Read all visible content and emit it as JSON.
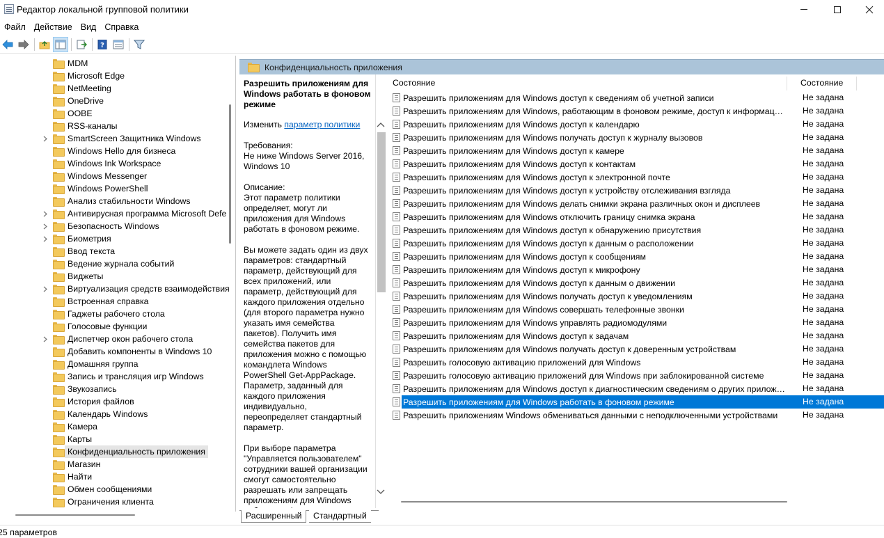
{
  "window": {
    "title": "Редактор локальной групповой политики"
  },
  "menu": [
    "Файл",
    "Действие",
    "Вид",
    "Справка"
  ],
  "toolbar": {
    "icons": [
      "back-arrow-icon",
      "forward-arrow-icon",
      "up-folder-icon",
      "show-hide-tree-icon",
      "export-list-icon",
      "help-icon",
      "properties-icon",
      "filter-icon"
    ]
  },
  "tree": {
    "items": [
      {
        "label": "MDM",
        "expandable": false
      },
      {
        "label": "Microsoft Edge",
        "expandable": false
      },
      {
        "label": "NetMeeting",
        "expandable": false
      },
      {
        "label": "OneDrive",
        "expandable": false
      },
      {
        "label": "OOBE",
        "expandable": false
      },
      {
        "label": "RSS-каналы",
        "expandable": false
      },
      {
        "label": "SmartScreen Защитника Windows",
        "expandable": true
      },
      {
        "label": "Windows Hello для бизнеса",
        "expandable": false
      },
      {
        "label": "Windows Ink Workspace",
        "expandable": false
      },
      {
        "label": "Windows Messenger",
        "expandable": false
      },
      {
        "label": "Windows PowerShell",
        "expandable": false
      },
      {
        "label": "Анализ стабильности Windows",
        "expandable": false
      },
      {
        "label": "Антивирусная программа Microsoft Defe",
        "expandable": true
      },
      {
        "label": "Безопасность Windows",
        "expandable": true
      },
      {
        "label": "Биометрия",
        "expandable": true
      },
      {
        "label": "Ввод текста",
        "expandable": false
      },
      {
        "label": "Ведение журнала событий",
        "expandable": false
      },
      {
        "label": "Виджеты",
        "expandable": false
      },
      {
        "label": "Виртуализация средств взаимодействия",
        "expandable": true
      },
      {
        "label": "Встроенная справка",
        "expandable": false
      },
      {
        "label": "Гаджеты рабочего стола",
        "expandable": false
      },
      {
        "label": "Голосовые функции",
        "expandable": false
      },
      {
        "label": "Диспетчер окон рабочего стола",
        "expandable": true
      },
      {
        "label": "Добавить компоненты в Windows 10",
        "expandable": false
      },
      {
        "label": "Домашняя группа",
        "expandable": false
      },
      {
        "label": "Запись и трансляция игр Windows",
        "expandable": false
      },
      {
        "label": "Звукозапись",
        "expandable": false
      },
      {
        "label": "История файлов",
        "expandable": false
      },
      {
        "label": "Календарь Windows",
        "expandable": false
      },
      {
        "label": "Камера",
        "expandable": false
      },
      {
        "label": "Карты",
        "expandable": false
      },
      {
        "label": "Конфиденциальность приложения",
        "expandable": false,
        "selected": true
      },
      {
        "label": "Магазин",
        "expandable": false
      },
      {
        "label": "Найти",
        "expandable": false
      },
      {
        "label": "Обмен сообщениями",
        "expandable": false
      },
      {
        "label": "Ограничения клиента",
        "expandable": false
      }
    ]
  },
  "section": {
    "title": "Конфиденциальность приложения"
  },
  "description": {
    "title": "Разрешить приложениям для Windows работать в фоновом режиме",
    "edit_prefix": "Изменить",
    "edit_link": "параметр политики",
    "requirements_label": "Требования:",
    "requirements_text": "Не ниже Windows Server 2016, Windows 10",
    "description_label": "Описание:",
    "p1": "Этот параметр политики определяет, могут ли приложения для Windows работать в фоновом режиме.",
    "p2": "Вы можете задать один из двух параметров: стандартный параметр, действующий для всех приложений, или параметр, действующий для каждого приложения отдельно (для второго параметра нужно указать имя семейства пакетов). Получить имя семейства пакетов для приложения можно с помощью командлета Windows PowerShell Get-AppPackage. Параметр, заданный для каждого приложения индивидуально, переопределяет стандартный параметр.",
    "p3": "При выборе параметра \"Управляется пользователем\" сотрудники вашей организации смогут самостоятельно разрешать или запрещать приложениям для Windows работать в фоновом"
  },
  "list": {
    "col_name": "Состояние",
    "col_status": "Состояние",
    "rows": [
      {
        "name": "Разрешить приложениям для Windows доступ к сведениям об учетной записи",
        "status": "Не задана"
      },
      {
        "name": "Разрешить приложениям для Windows, работающим в фоновом режиме, доступ к информации о движении",
        "status": "Не задана"
      },
      {
        "name": "Разрешить приложениям для Windows доступ к календарю",
        "status": "Не задана"
      },
      {
        "name": "Разрешить приложениям для Windows получать доступ к журналу вызовов",
        "status": "Не задана"
      },
      {
        "name": "Разрешить приложениям для Windows доступ к камере",
        "status": "Не задана"
      },
      {
        "name": "Разрешить приложениям для Windows доступ к контактам",
        "status": "Не задана"
      },
      {
        "name": "Разрешить приложениям для Windows доступ к электронной почте",
        "status": "Не задана"
      },
      {
        "name": "Разрешить приложениям для Windows доступ к устройству отслеживания взгляда",
        "status": "Не задана"
      },
      {
        "name": "Разрешить приложениям для Windows делать снимки экрана различных окон и дисплеев",
        "status": "Не задана"
      },
      {
        "name": "Разрешить приложениям для Windows отключить границу снимка экрана",
        "status": "Не задана"
      },
      {
        "name": "Разрешить приложениям для Windows доступ к обнаружению присутствия",
        "status": "Не задана"
      },
      {
        "name": "Разрешить приложениям для Windows доступ к данным о расположении",
        "status": "Не задана"
      },
      {
        "name": "Разрешить приложениям для Windows доступ к сообщениям",
        "status": "Не задана"
      },
      {
        "name": "Разрешить приложениям для Windows доступ к микрофону",
        "status": "Не задана"
      },
      {
        "name": "Разрешить приложениям для Windows доступ к данным о движении",
        "status": "Не задана"
      },
      {
        "name": "Разрешить приложениям для Windows получать доступ к уведомлениям",
        "status": "Не задана"
      },
      {
        "name": "Разрешить приложениям для Windows совершать телефонные звонки",
        "status": "Не задана"
      },
      {
        "name": "Разрешить приложениям для Windows управлять радиомодулями",
        "status": "Не задана"
      },
      {
        "name": "Разрешить приложениям для Windows доступ к задачам",
        "status": "Не задана"
      },
      {
        "name": "Разрешить приложениям для Windows получать доступ к доверенным устройствам",
        "status": "Не задана"
      },
      {
        "name": "Разрешить голосовую активацию приложений для Windows",
        "status": "Не задана"
      },
      {
        "name": "Разрешить голосовую активацию приложений для Windows при заблокированной системе",
        "status": "Не задана"
      },
      {
        "name": "Разрешить приложениям для Windows доступ к диагностическим сведениям о других приложениях",
        "status": "Не задана"
      },
      {
        "name": "Разрешить приложениям для Windows работать в фоновом режиме",
        "status": "Не задана",
        "selected": true
      },
      {
        "name": "Разрешить приложениям Windows обмениваться данными с неподключенными устройствами",
        "status": "Не задана"
      }
    ]
  },
  "tabs": {
    "extended": "Расширенный",
    "standard": "Стандартный"
  },
  "status": {
    "text": "25 параметров"
  },
  "colors": {
    "selection": "#0078d7",
    "section_header": "#abc4d9",
    "link": "#0563c1",
    "folder": "#f3c95c"
  }
}
